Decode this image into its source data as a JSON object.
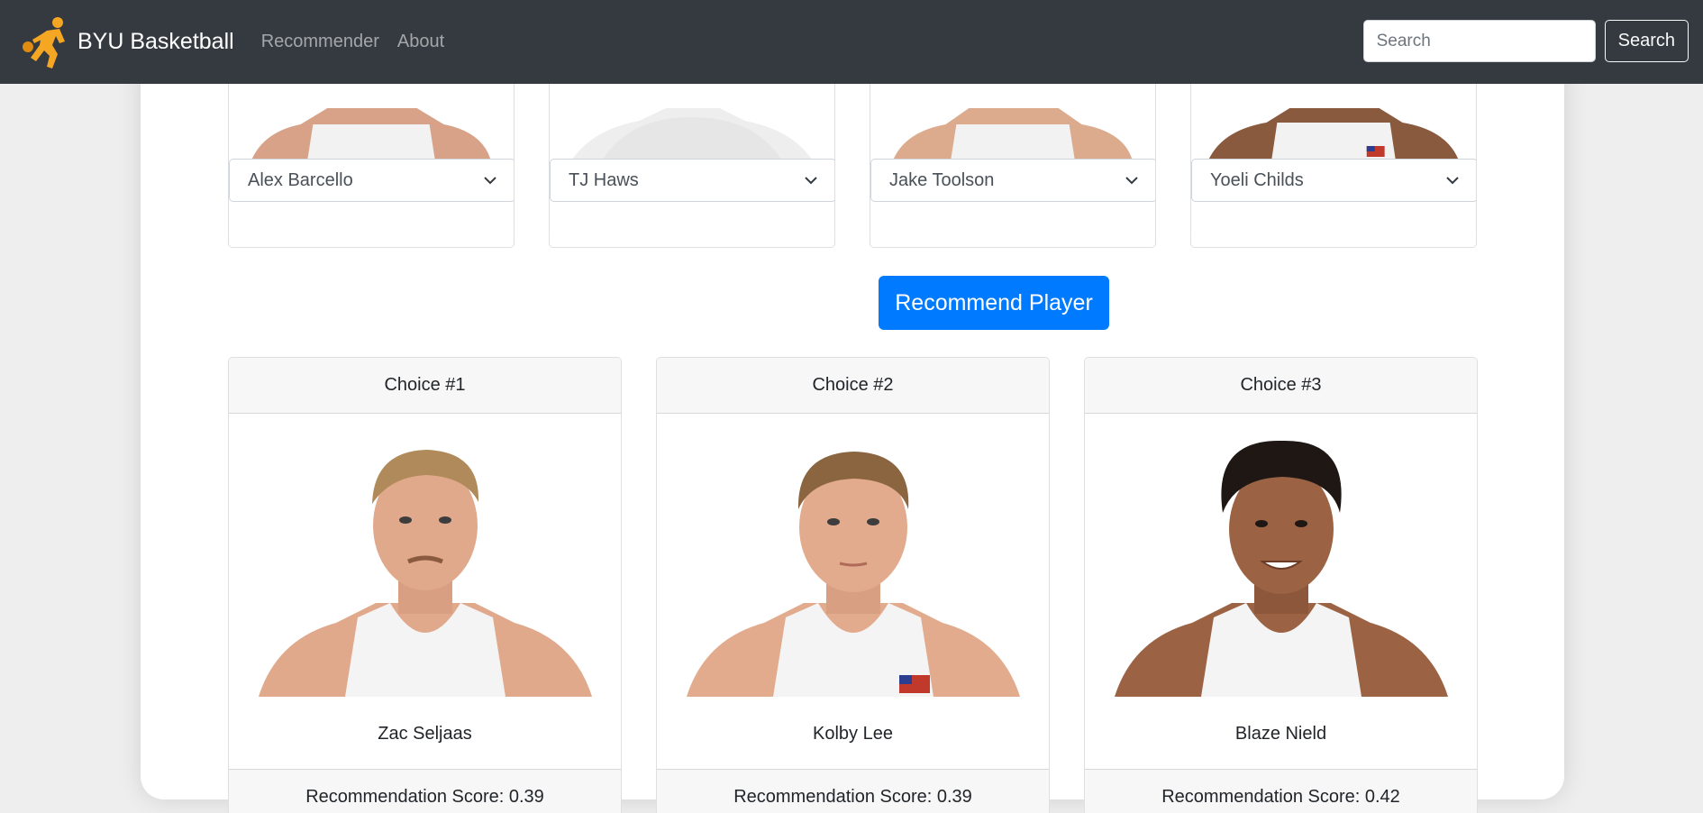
{
  "navbar": {
    "brand": "BYU Basketball",
    "links": [
      "Recommender",
      "About"
    ],
    "search_placeholder": "Search",
    "search_button": "Search",
    "logo_icon": "basketball-player-icon",
    "colors": {
      "background": "#343a40",
      "logo": "#f5a623"
    }
  },
  "selections": [
    {
      "selected": "Alex Barcello"
    },
    {
      "selected": "TJ Haws"
    },
    {
      "selected": "Jake Toolson"
    },
    {
      "selected": "Yoeli Childs"
    }
  ],
  "recommend_button": "Recommend Player",
  "choices": [
    {
      "header": "Choice #1",
      "name": "Zac Seljaas",
      "score": "Recommendation Score: 0.39",
      "hair": "#b08a5a",
      "skin": "#e0a98c"
    },
    {
      "header": "Choice #2",
      "name": "Kolby Lee",
      "score": "Recommendation Score: 0.39",
      "hair": "#8a6540",
      "skin": "#e3ab8d"
    },
    {
      "header": "Choice #3",
      "name": "Blaze Nield",
      "score": "Recommendation Score: 0.42",
      "hair": "#1e1714",
      "skin": "#9b6344"
    }
  ],
  "colors": {
    "primary": "#007bff",
    "card_header": "#f7f7f7"
  }
}
